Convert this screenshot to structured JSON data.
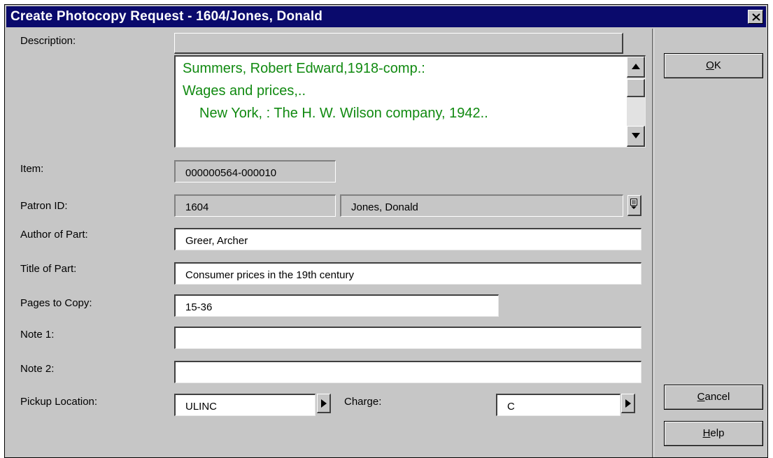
{
  "window": {
    "title": "Create Photocopy Request - 1604/Jones, Donald",
    "close_icon": "close-x-icon"
  },
  "form": {
    "description_label": "Description:",
    "description_lines": [
      "Summers, Robert Edward,1918-comp.:",
      "Wages and prices,..",
      "New York, : The H. W. Wilson company, 1942.."
    ],
    "item_label": "Item:",
    "item_value": "000000564-000010",
    "patron_label": "Patron ID:",
    "patron_id": "1604",
    "patron_name": "Jones, Donald",
    "author_label": "Author of Part:",
    "author_value": "Greer, Archer",
    "title_label": "Title of Part:",
    "title_value": "Consumer prices in the 19th century",
    "pages_label": "Pages to Copy:",
    "pages_value": "15-36",
    "note1_label": "Note 1:",
    "note1_value": "",
    "note2_label": "Note 2:",
    "note2_value": "",
    "pickup_label": "Pickup Location:",
    "pickup_value": "ULINC",
    "charge_label": "Charge:",
    "charge_value": "C"
  },
  "buttons": {
    "ok_prefix": "",
    "ok_mnemonic": "O",
    "ok_rest": "K",
    "cancel_mnemonic": "C",
    "cancel_rest": "ancel",
    "help_mnemonic": "H",
    "help_rest": "elp"
  },
  "colors": {
    "title_bar": "#0a0a6c",
    "dialog_bg": "#c6c6c6",
    "description_text": "#118a11"
  }
}
